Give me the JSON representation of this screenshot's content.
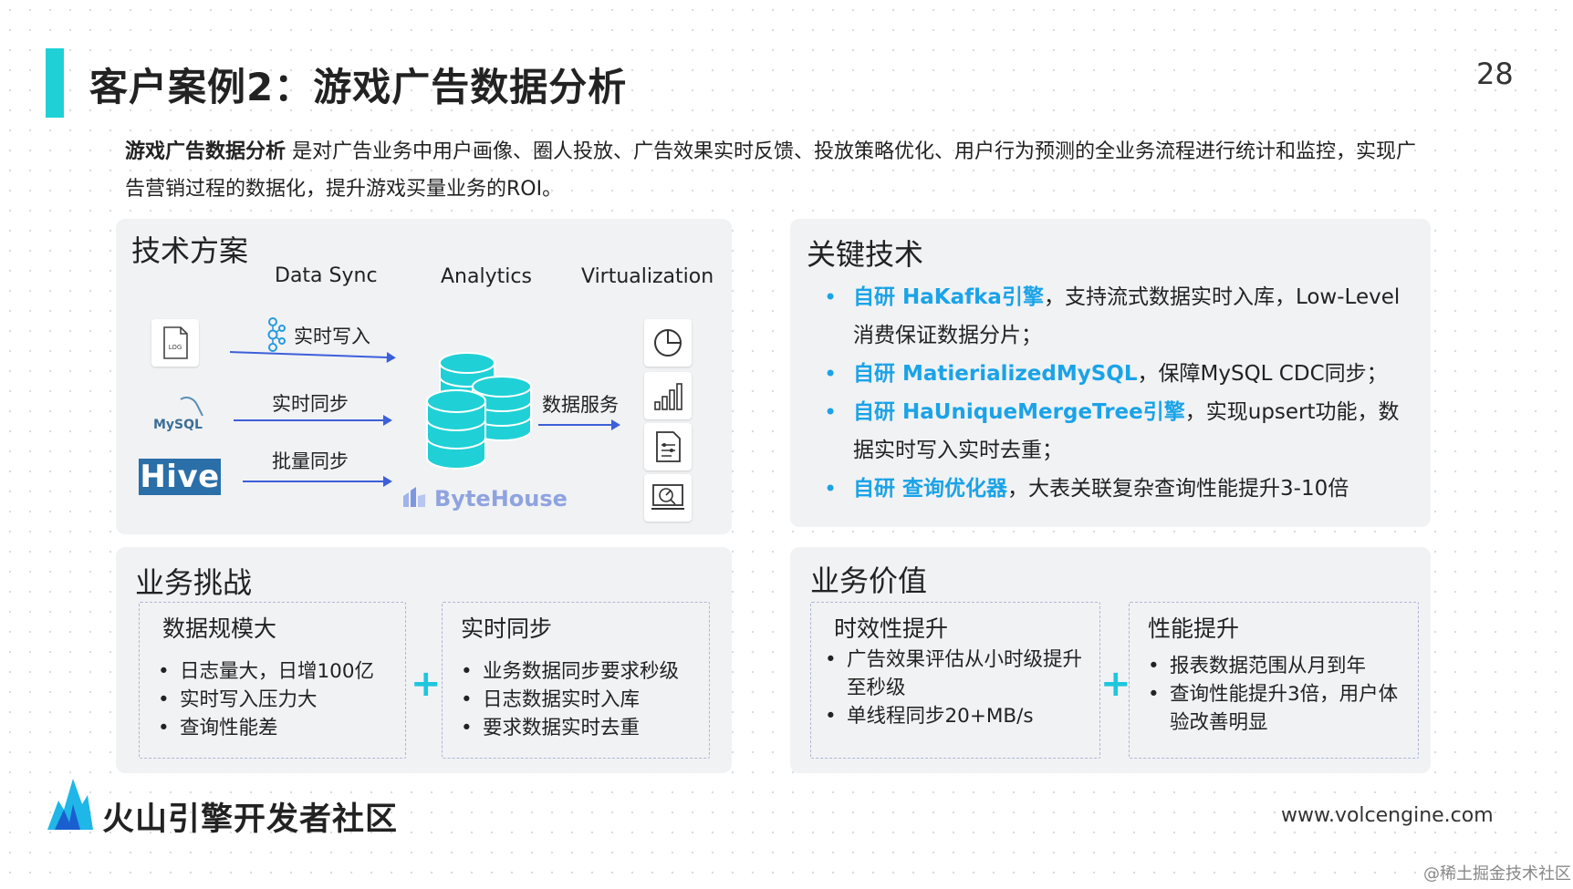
{
  "header": {
    "title": "客户案例2：游戏广告数据分析",
    "page_number": "28"
  },
  "intro": {
    "bold": "游戏广告数据分析",
    "text": " 是对广告业务中用户画像、圈人投放、广告效果实时反馈、投放策略优化、用户行为预测的全业务流程进行统计和监控，实现广告营销过程的数据化，提升游戏买量业务的ROI。"
  },
  "tech": {
    "title": "技术方案",
    "columns": [
      "Data Sync",
      "Analytics",
      "Virtualization"
    ],
    "sources": [
      {
        "icon": "log-file-icon",
        "label": "LOG"
      },
      {
        "icon": "mysql-logo-icon",
        "label": "MySQL"
      },
      {
        "icon": "hive-logo-icon",
        "label": "Hive"
      }
    ],
    "flows": [
      "实时写入",
      "实时同步",
      "批量同步"
    ],
    "service_label": "数据服务",
    "engine_name": "ByteHouse",
    "outputs": [
      "pie-chart-icon",
      "bar-chart-icon",
      "report-icon",
      "dashboard-icon"
    ]
  },
  "key_tech": {
    "title": "关键技术",
    "items": [
      {
        "hl": "自研 HaKafka引擎",
        "text": "，支持流式数据实时入库，Low-Level消费保证数据分片；"
      },
      {
        "hl": "自研 MatierializedMySQL",
        "text": "，保障MySQL CDC同步；"
      },
      {
        "hl": "自研 HaUniqueMergeTree引擎",
        "text": "，实现upsert功能，数据实时写入实时去重；"
      },
      {
        "hl": "自研 查询优化器",
        "text": "，大表关联复杂查询性能提升3-10倍"
      }
    ]
  },
  "challenges": {
    "title": "业务挑战",
    "boxes": [
      {
        "title": "数据规模大",
        "items": [
          "日志量大，日增100亿",
          "实时写入压力大",
          "查询性能差"
        ]
      },
      {
        "title": "实时同步",
        "items": [
          "业务数据同步要求秒级",
          "日志数据实时入库",
          "要求数据实时去重"
        ]
      }
    ]
  },
  "value": {
    "title": "业务价值",
    "boxes": [
      {
        "title": "时效性提升",
        "items": [
          "广告效果评估从小时级提升至秒级",
          "单线程同步20+MB/s"
        ]
      },
      {
        "title": "性能提升",
        "items": [
          "报表数据范围从月到年",
          "查询性能提升3倍，用户体验改善明显"
        ]
      }
    ]
  },
  "plus_symbol": "+",
  "footer": {
    "brand": "火山引擎开发者社区",
    "url": "www.volcengine.com",
    "watermark": "@稀土掘金技术社区"
  },
  "colors": {
    "accent": "#1fd1d6",
    "highlight": "#1aa3e8",
    "arrow": "#3d5fd9",
    "panel_bg": "#f1f2f4"
  }
}
